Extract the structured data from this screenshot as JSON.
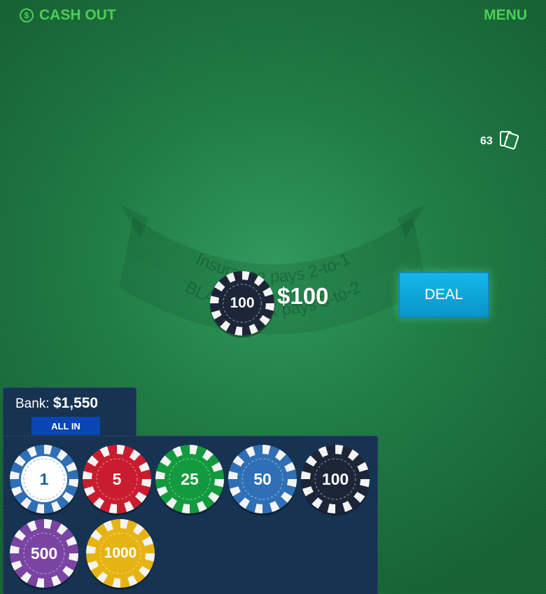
{
  "header": {
    "cashout_label": "CASH OUT",
    "cashout_icon_glyph": "$",
    "menu_label": "MENU"
  },
  "deck": {
    "count": "63",
    "icon": "cards-icon"
  },
  "table": {
    "insurance_text": "Insurance pays 2-to-1",
    "blackjack_text": "BLACKJACK pays 3-to-2"
  },
  "bet": {
    "chip_label": "100",
    "amount": "$100"
  },
  "deal_button": {
    "label": "DEAL"
  },
  "bank": {
    "label": "Bank:",
    "amount": "$1,550",
    "all_in_label": "ALL IN"
  },
  "chips": [
    {
      "label": "1",
      "color": "#2f6fb5"
    },
    {
      "label": "5",
      "color": "#c91d2f"
    },
    {
      "label": "25",
      "color": "#139a3e"
    },
    {
      "label": "50",
      "color": "#2f6fb5"
    },
    {
      "label": "100",
      "color": "#1d2638"
    },
    {
      "label": "500",
      "color": "#7a44a3"
    },
    {
      "label": "1000",
      "color": "#e6b412"
    }
  ]
}
